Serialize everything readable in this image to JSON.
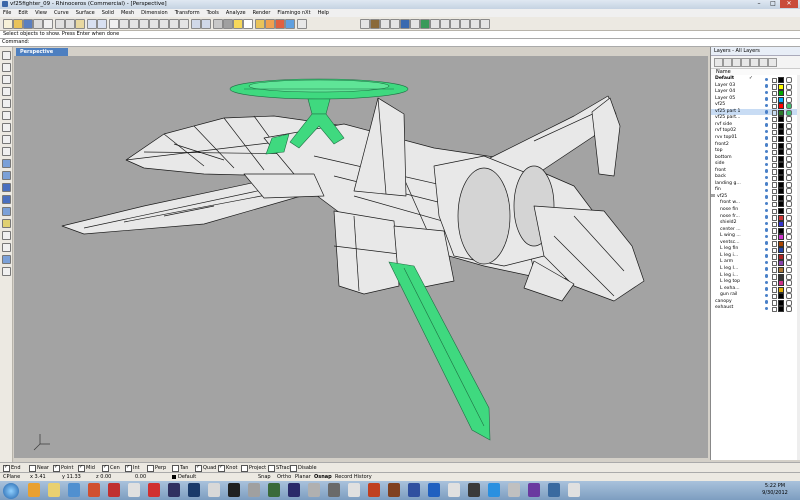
{
  "window": {
    "title": "vf25fighter_09 - Rhinoceros (Commercial) - [Perspective]",
    "minimize": "–",
    "maximize": "□",
    "close": "✕"
  },
  "menu": [
    "File",
    "Edit",
    "View",
    "Curve",
    "Surface",
    "Solid",
    "Mesh",
    "Dimension",
    "Transform",
    "Tools",
    "Analyze",
    "Render",
    "Flamingo nXt",
    "Help"
  ],
  "command": {
    "history": "Select objects to show. Press Enter when done",
    "prompt": "Command:",
    "value": ""
  },
  "viewport": {
    "title": "Perspective"
  },
  "layers": {
    "panel_title": "Layers - All Layers",
    "column_name": "Name",
    "items": [
      {
        "name": "Default",
        "indent": 0,
        "bold": true,
        "current": "✓",
        "color": "#000000",
        "material": "#ffffff"
      },
      {
        "name": "Layer 03",
        "indent": 0,
        "color": "#ffff00",
        "material": "#ffffff"
      },
      {
        "name": "Layer 04",
        "indent": 0,
        "color": "#00aa00",
        "material": "#ffffff"
      },
      {
        "name": "Layer 05",
        "indent": 0,
        "color": "#00aaff",
        "material": "#ffffff"
      },
      {
        "name": "vf25",
        "indent": 0,
        "color": "#ff0000",
        "material": "#40c070"
      },
      {
        "name": "vf25 part 1",
        "indent": 0,
        "selected": true,
        "color": "#2a7a2a",
        "material": "#40c070"
      },
      {
        "name": "vf25 part...",
        "indent": 0,
        "color": "#000000",
        "material": "#ffffff"
      },
      {
        "name": "rvf side",
        "indent": 0,
        "color": "#000000",
        "material": "#ffffff"
      },
      {
        "name": "rvf top02",
        "indent": 0,
        "color": "#000000",
        "material": "#ffffff"
      },
      {
        "name": "rvv top01",
        "indent": 0,
        "color": "#000000",
        "material": "#ffffff"
      },
      {
        "name": "front2",
        "indent": 0,
        "color": "#000000",
        "material": "#ffffff"
      },
      {
        "name": "top",
        "indent": 0,
        "color": "#000000",
        "material": "#ffffff"
      },
      {
        "name": "bottom",
        "indent": 0,
        "color": "#000000",
        "material": "#ffffff"
      },
      {
        "name": "side",
        "indent": 0,
        "color": "#000000",
        "material": "#ffffff"
      },
      {
        "name": "front",
        "indent": 0,
        "color": "#000000",
        "material": "#ffffff"
      },
      {
        "name": "back",
        "indent": 0,
        "color": "#000000",
        "material": "#ffffff"
      },
      {
        "name": "landing g...",
        "indent": 0,
        "color": "#000000",
        "material": "#ffffff"
      },
      {
        "name": "fin",
        "indent": 0,
        "color": "#000000",
        "material": "#ffffff"
      },
      {
        "name": "vf25",
        "indent": 0,
        "expander": "⊟",
        "color": "#000000",
        "material": "#ffffff"
      },
      {
        "name": "front w...",
        "indent": 1,
        "color": "#000000",
        "material": "#ffffff"
      },
      {
        "name": "nose fin",
        "indent": 1,
        "color": "#000000",
        "material": "#ffffff"
      },
      {
        "name": "nose fr...",
        "indent": 1,
        "color": "#cc3333",
        "material": "#ffffff"
      },
      {
        "name": "shield2",
        "indent": 1,
        "color": "#3333cc",
        "material": "#ffffff"
      },
      {
        "name": "center ...",
        "indent": 1,
        "color": "#000000",
        "material": "#ffffff"
      },
      {
        "name": "L wing ...",
        "indent": 1,
        "color": "#cc33cc",
        "material": "#ffffff"
      },
      {
        "name": "ventsc...",
        "indent": 1,
        "color": "#aa4400",
        "material": "#ffffff"
      },
      {
        "name": "L leg fin",
        "indent": 1,
        "color": "#2244aa",
        "material": "#ffffff"
      },
      {
        "name": "L leg i...",
        "indent": 1,
        "color": "#aa2222",
        "material": "#ffffff"
      },
      {
        "name": "L arm",
        "indent": 1,
        "color": "#8844aa",
        "material": "#ffffff"
      },
      {
        "name": "L leg I...",
        "indent": 1,
        "color": "#aa7733",
        "material": "#ffffff"
      },
      {
        "name": "L leg i...",
        "indent": 1,
        "color": "#333333",
        "material": "#ffffff"
      },
      {
        "name": "L leg top",
        "indent": 1,
        "color": "#cc3388",
        "material": "#ffffff"
      },
      {
        "name": "L exha...",
        "indent": 1,
        "color": "#ddaa00",
        "material": "#ffffff"
      },
      {
        "name": "gun rail",
        "indent": 1,
        "color": "#000000",
        "material": "#ffffff"
      },
      {
        "name": "canopy",
        "indent": 0,
        "color": "#000000",
        "material": "#ffffff"
      },
      {
        "name": "exhaust",
        "indent": 0,
        "color": "#000000",
        "material": "#ffffff"
      }
    ]
  },
  "osnaps": [
    {
      "label": "End",
      "checked": true
    },
    {
      "label": "Near",
      "checked": false
    },
    {
      "label": "Point",
      "checked": true
    },
    {
      "label": "Mid",
      "checked": true
    },
    {
      "label": "Cen",
      "checked": true
    },
    {
      "label": "Int",
      "checked": true
    },
    {
      "label": "Perp",
      "checked": false
    },
    {
      "label": "Tan",
      "checked": false
    },
    {
      "label": "Quad",
      "checked": true
    },
    {
      "label": "Knot",
      "checked": true
    },
    {
      "label": "Project",
      "checked": false
    },
    {
      "label": "STrack",
      "checked": false
    },
    {
      "label": "Disable",
      "checked": false
    }
  ],
  "status": {
    "cplane": "CPlane",
    "x": "x 3.41",
    "y": "y 11.33",
    "z": "z 0.00",
    "dist": "0.00",
    "layer": "Default",
    "snap": "Snap",
    "ortho": "Ortho",
    "planar": "Planar",
    "osnap": "Osnap",
    "history": "Record History"
  },
  "taskbar": {
    "time": "5:22 PM",
    "date": "9/30/2012"
  },
  "colors": {
    "model_green": "#3fd97f",
    "viewport_bg": "#a3a3a3",
    "active_tab": "#4d7fc0"
  }
}
